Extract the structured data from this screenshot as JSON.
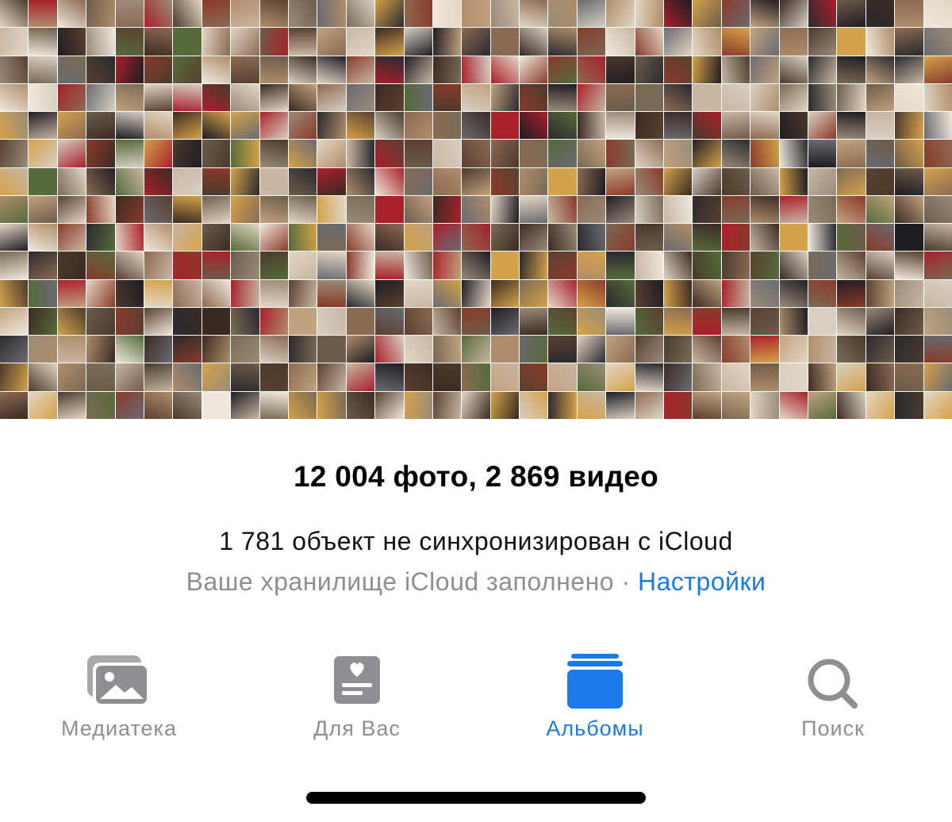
{
  "summary": {
    "count_text": "12 004 фото, 2 869 видео",
    "unsynced_text": "1 781 объект не синхронизирован с iCloud",
    "storage_text": "Ваше хранилище iCloud заполнено",
    "separator": "·",
    "settings_link": "Настройки"
  },
  "tabs": [
    {
      "label": "Медиатека",
      "icon": "photo-library-icon",
      "active": false
    },
    {
      "label": "Для Вас",
      "icon": "for-you-icon",
      "active": false
    },
    {
      "label": "Альбомы",
      "icon": "albums-icon",
      "active": true
    },
    {
      "label": "Поиск",
      "icon": "search-icon",
      "active": false
    }
  ],
  "colors": {
    "accent": "#1a7ae8",
    "inactive": "#8e8e93",
    "text": "#000000"
  },
  "mosaic": {
    "tile_colors": [
      "#3b2a22",
      "#8c6a52",
      "#c9b6a3",
      "#5a4030",
      "#a8202a",
      "#6d5c4a",
      "#d8cfc2",
      "#2a2a2e",
      "#b08d6a",
      "#e3d6c4",
      "#7a6a55",
      "#4a3a2c",
      "#c2a27e",
      "#9a8b78",
      "#1f1c22",
      "#d4a24a",
      "#556b3a",
      "#f0e8dc",
      "#8a3a2a",
      "#6a6a70"
    ]
  }
}
